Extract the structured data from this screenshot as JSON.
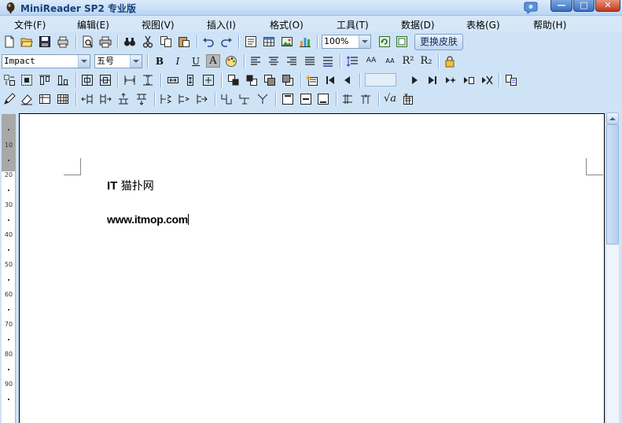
{
  "window": {
    "title": "MiniReader SP2 专业版",
    "minimize_glyph": "—",
    "maximize_glyph": "□",
    "close_glyph": "✕"
  },
  "menu": {
    "items": [
      "文件(F)",
      "编辑(E)",
      "视图(V)",
      "插入(I)",
      "格式(O)",
      "工具(T)",
      "数据(D)",
      "表格(G)",
      "帮助(H)"
    ]
  },
  "toolbar": {
    "zoom_value": "100%",
    "skin_button_label": "更换皮肤",
    "font_name": "Impact",
    "font_size": "五号",
    "bold_glyph": "B",
    "italic_glyph": "I",
    "underline_glyph": "U",
    "fontcolor_glyph": "A",
    "superscript_label": "R²",
    "subscript_label": "R₂",
    "grow_font_label": "AA",
    "shrink_font_label": "AA",
    "sqrt_label": "√a"
  },
  "document": {
    "line1_bold": "IT",
    "line1_rest": " 猫扑网",
    "line2": "www.itmop.com"
  },
  "ruler": {
    "marks": [
      "10",
      "20",
      "30",
      "40",
      "50",
      "60",
      "70",
      "80",
      "90"
    ]
  },
  "colors": {
    "chrome_background": "#cfe3f7",
    "menu_background": "#d6e7f8",
    "title_text": "#1a3f7a",
    "close_button": "#c0381c"
  }
}
